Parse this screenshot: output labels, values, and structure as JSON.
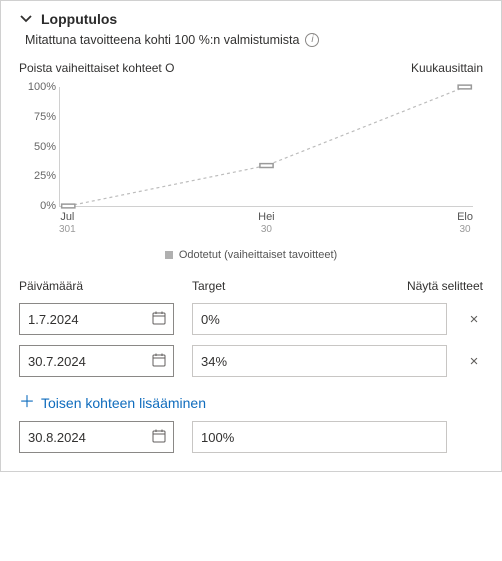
{
  "header": {
    "title": "Lopputulos",
    "subtitle": "Mitattuna tavoitteena kohti 100 %:n valmistumista"
  },
  "toolbar": {
    "left": "Poista vaiheittaiset kohteet O",
    "right": "Kuukausittain"
  },
  "chart_data": {
    "type": "line",
    "categories": [
      "Jul",
      "Hei",
      "Elo"
    ],
    "category_sub": [
      "301",
      "30",
      "30"
    ],
    "values": [
      0,
      34,
      100
    ],
    "ylabel": "",
    "ylim": [
      0,
      100
    ],
    "yticks": [
      "0%",
      "25%",
      "50%",
      "75%",
      "100%"
    ],
    "legend": "Odotetut (vaiheittaiset tavoitteet)"
  },
  "columns": {
    "date": "Päivämäärä",
    "target": "Target",
    "show_legends": "Näytä selitteet"
  },
  "rows": [
    {
      "date": "1.7.2024",
      "target": "0%",
      "removable": true
    },
    {
      "date": "30.7.2024",
      "target": "34%",
      "removable": true
    }
  ],
  "add_link": "Toisen kohteen lisääminen",
  "final_row": {
    "date": "30.8.2024",
    "target": "100%"
  }
}
